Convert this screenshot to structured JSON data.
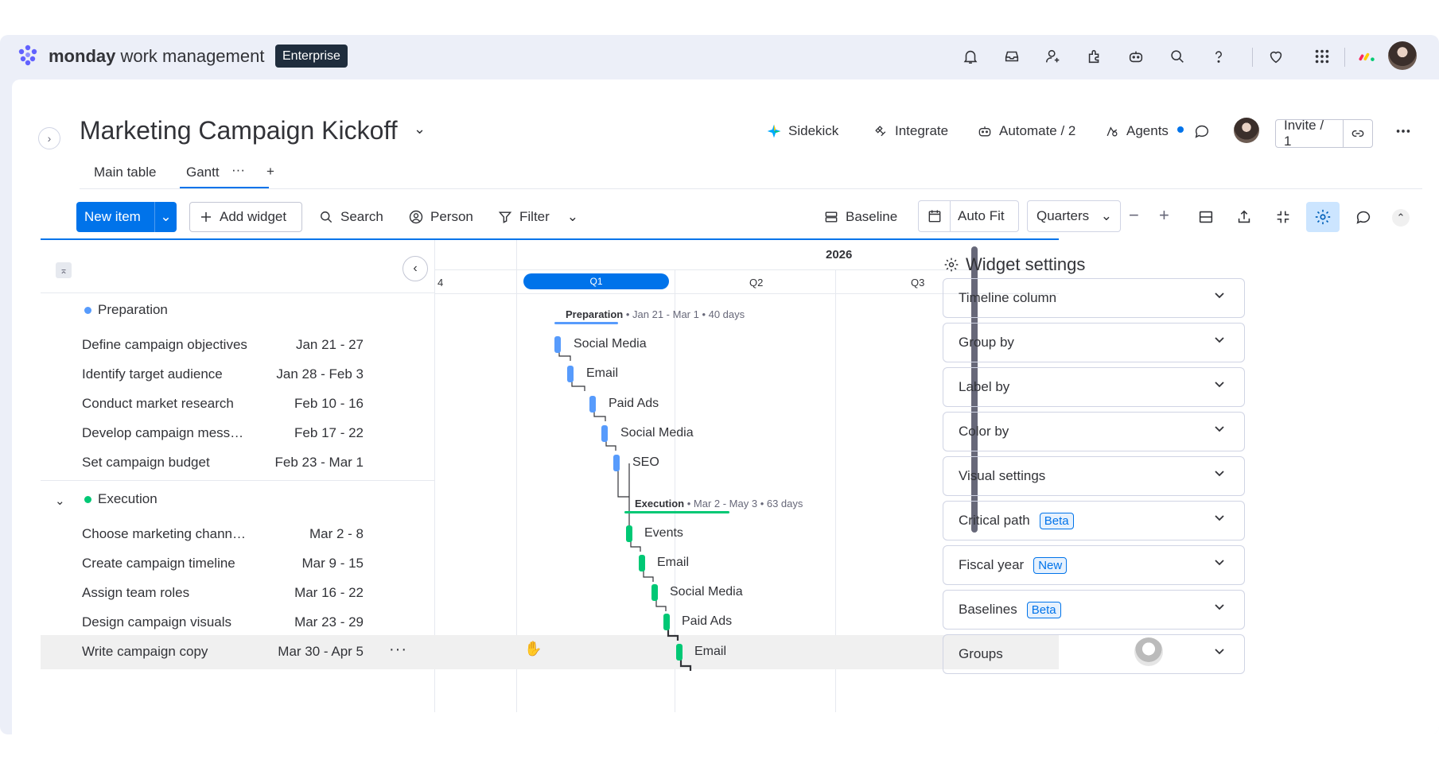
{
  "topbar": {
    "brand_bold": "monday",
    "brand_rest": " work management",
    "plan": "Enterprise",
    "icons": [
      "bell-icon",
      "inbox-icon",
      "invite-member-icon",
      "apps-icon",
      "ai-bot-icon",
      "search-icon",
      "help-icon",
      "heart-icon",
      "apps-grid-icon",
      "monday-logo-icon",
      "avatar"
    ]
  },
  "board": {
    "title": "Marketing Campaign Kickoff",
    "actions": {
      "sidekick": "Sidekick",
      "integrate": "Integrate",
      "automate": "Automate / 2",
      "agents": "Agents"
    },
    "invite": "Invite / 1",
    "tabs": [
      {
        "label": "Main table"
      },
      {
        "label": "Gantt",
        "more": "···"
      }
    ],
    "add_tab": "+"
  },
  "toolbar": {
    "new_item": "New item",
    "add_widget": "Add widget",
    "search": "Search",
    "person": "Person",
    "filter": "Filter",
    "baseline": "Baseline",
    "auto_fit": "Auto Fit",
    "quarters": "Quarters",
    "zoom_out": "−",
    "zoom_in": "+"
  },
  "gantt": {
    "year": "2026",
    "quarters": [
      "4",
      "Q1",
      "Q2",
      "Q3"
    ],
    "groups": [
      {
        "name": "Preparation",
        "color": "#579bfc",
        "summary_name": "Preparation",
        "summary_dates": " • Jan 21 - Mar 1 • 40 days",
        "items": [
          {
            "name": "Define campaign objectives",
            "dates": "Jan 21 - 27",
            "label": "Social Media"
          },
          {
            "name": "Identify target audience",
            "dates": "Jan 28 - Feb 3",
            "label": "Email"
          },
          {
            "name": "Conduct market research",
            "dates": "Feb 10 - 16",
            "label": "Paid Ads"
          },
          {
            "name": "Develop campaign messag...",
            "dates": "Feb 17 - 22",
            "label": "Social Media"
          },
          {
            "name": "Set campaign budget",
            "dates": "Feb 23 - Mar 1",
            "label": "SEO"
          }
        ]
      },
      {
        "name": "Execution",
        "color": "#00c875",
        "summary_name": "Execution",
        "summary_dates": " • Mar 2 - May 3 • 63 days",
        "items": [
          {
            "name": "Choose marketing channels",
            "dates": "Mar 2 - 8",
            "label": "Events"
          },
          {
            "name": "Create campaign timeline",
            "dates": "Mar 9 - 15",
            "label": "Email"
          },
          {
            "name": "Assign team roles",
            "dates": "Mar 16 - 22",
            "label": "Social Media"
          },
          {
            "name": "Design campaign visuals",
            "dates": "Mar 23 - 29",
            "label": "Paid Ads"
          },
          {
            "name": "Write campaign copy",
            "dates": "Mar 30 - Apr 5",
            "label": "Email",
            "more": "···"
          }
        ]
      }
    ]
  },
  "widget_settings": {
    "title": "Widget settings",
    "sections": [
      {
        "label": "Timeline column",
        "badge": ""
      },
      {
        "label": "Group by",
        "badge": ""
      },
      {
        "label": "Label by",
        "badge": ""
      },
      {
        "label": "Color by",
        "badge": ""
      },
      {
        "label": "Visual settings",
        "badge": ""
      },
      {
        "label": "Critical path",
        "badge": "Beta"
      },
      {
        "label": "Fiscal year",
        "badge": "New"
      },
      {
        "label": "Baselines",
        "badge": "Beta"
      },
      {
        "label": "Groups",
        "badge": ""
      }
    ]
  }
}
